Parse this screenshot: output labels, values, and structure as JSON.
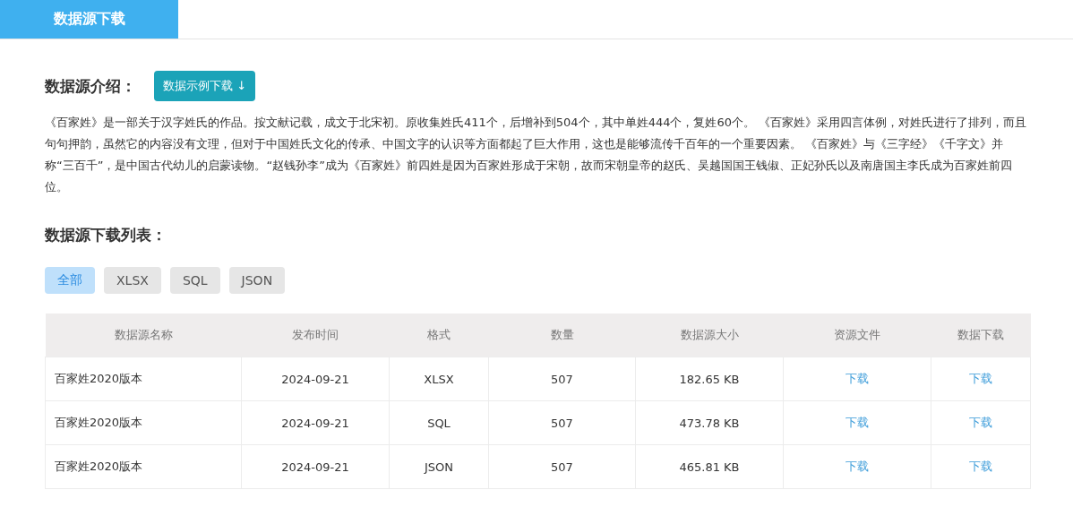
{
  "tabs": [
    {
      "label": "数据源下载",
      "selected": true
    }
  ],
  "intro": {
    "heading": "数据源介绍：",
    "sample_button": "数据示例下载 ↓",
    "text": "《百家姓》是一部关于汉字姓氏的作品。按文献记载，成文于北宋初。原收集姓氏411个，后增补到504个，其中单姓444个，复姓60个。 《百家姓》采用四言体例，对姓氏进行了排列，而且句句押韵，虽然它的内容没有文理，但对于中国姓氏文化的传承、中国文字的认识等方面都起了巨大作用，这也是能够流传千百年的一个重要因素。 《百家姓》与《三字经》《千字文》并称“三百千”，是中国古代幼儿的启蒙读物。“赵钱孙李”成为《百家姓》前四姓是因为百家姓形成于宋朝，故而宋朝皇帝的赵氏、吴越国国王钱俶、正妃孙氏以及南唐国主李氏成为百家姓前四位。"
  },
  "list": {
    "heading": "数据源下载列表：",
    "filters": [
      {
        "label": "全部",
        "selected": true
      },
      {
        "label": "XLSX",
        "selected": false
      },
      {
        "label": "SQL",
        "selected": false
      },
      {
        "label": "JSON",
        "selected": false
      }
    ],
    "table": {
      "columns": [
        "数据源名称",
        "发布时间",
        "格式",
        "数量",
        "数据源大小",
        "资源文件",
        "数据下载"
      ],
      "rows": [
        {
          "name": "百家姓2020版本",
          "date": "2024-09-21",
          "format": "XLSX",
          "count": "507",
          "size": "182.65 KB",
          "resource_link": "下载",
          "download_link": "下载"
        },
        {
          "name": "百家姓2020版本",
          "date": "2024-09-21",
          "format": "SQL",
          "count": "507",
          "size": "473.78 KB",
          "resource_link": "下载",
          "download_link": "下载"
        },
        {
          "name": "百家姓2020版本",
          "date": "2024-09-21",
          "format": "JSON",
          "count": "507",
          "size": "465.81 KB",
          "resource_link": "下载",
          "download_link": "下载"
        }
      ]
    }
  }
}
